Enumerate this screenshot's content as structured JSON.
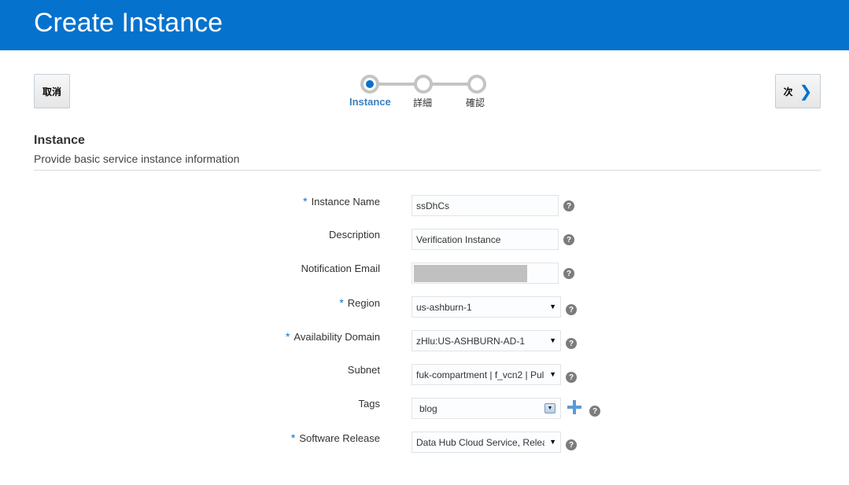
{
  "header": {
    "title": "Create Instance"
  },
  "toolbar": {
    "cancel_label": "取消",
    "next_label": "次"
  },
  "train": {
    "steps": [
      {
        "label": "Instance",
        "active": true
      },
      {
        "label": "詳細",
        "active": false
      },
      {
        "label": "確認",
        "active": false
      }
    ]
  },
  "section": {
    "title": "Instance",
    "subtitle": "Provide basic service instance information"
  },
  "form": {
    "instance_name": {
      "label": "Instance Name",
      "required": true,
      "value": "ssDhCs"
    },
    "description": {
      "label": "Description",
      "required": false,
      "value": "Verification Instance"
    },
    "notification_email": {
      "label": "Notification Email",
      "required": false,
      "value": ""
    },
    "region": {
      "label": "Region",
      "required": true,
      "value": "us-ashburn-1"
    },
    "availability_domain": {
      "label": "Availability Domain",
      "required": true,
      "value": "zHlu:US-ASHBURN-AD-1"
    },
    "subnet": {
      "label": "Subnet",
      "required": false,
      "value": "fuk-compartment | f_vcn2 | Pul"
    },
    "tags": {
      "label": "Tags",
      "required": false,
      "value": "blog"
    },
    "software_release": {
      "label": "Software Release",
      "required": true,
      "value": "Data Hub Cloud Service, Relea"
    }
  },
  "common": {
    "required_mark": "*",
    "help_glyph": "?",
    "select_arrow": "▼",
    "chevron": "❯"
  },
  "colors": {
    "header_bg": "#0572ce",
    "accent": "#0572ce",
    "required": "#0572ce"
  }
}
